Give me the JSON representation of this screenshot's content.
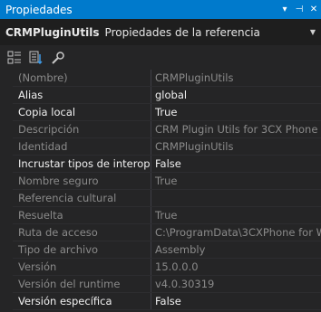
{
  "window": {
    "title": "Propiedades",
    "controls": [
      "▾",
      "⊣",
      "✕"
    ]
  },
  "object": {
    "name": "CRMPluginUtils",
    "type": "Propiedades de la referencia",
    "dropdown_glyph": "▼"
  },
  "toolbar": {
    "buttons": [
      "categorized-icon",
      "alphabetical-icon",
      "property-pages-icon"
    ]
  },
  "properties": [
    {
      "name": "(Nombre)",
      "value": "CRMPluginUtils",
      "editable": false
    },
    {
      "name": "Alias",
      "value": "global",
      "editable": true
    },
    {
      "name": "Copia local",
      "value": "True",
      "editable": true
    },
    {
      "name": "Descripción",
      "value": "CRM Plugin Utils for 3CX Phone S",
      "editable": false
    },
    {
      "name": "Identidad",
      "value": "CRMPluginUtils",
      "editable": false
    },
    {
      "name": "Incrustar tipos de interop",
      "value": "False",
      "editable": true
    },
    {
      "name": "Nombre seguro",
      "value": "True",
      "editable": false
    },
    {
      "name": "Referencia cultural",
      "value": "",
      "editable": false
    },
    {
      "name": "Resuelta",
      "value": "True",
      "editable": false
    },
    {
      "name": "Ruta de acceso",
      "value": "C:\\ProgramData\\3CXPhone for W",
      "editable": false
    },
    {
      "name": "Tipo de archivo",
      "value": "Assembly",
      "editable": false
    },
    {
      "name": "Versión",
      "value": "15.0.0.0",
      "editable": false
    },
    {
      "name": "Versión del runtime",
      "value": "v4.0.30319",
      "editable": false
    },
    {
      "name": "Versión específica",
      "value": "False",
      "editable": true
    }
  ]
}
